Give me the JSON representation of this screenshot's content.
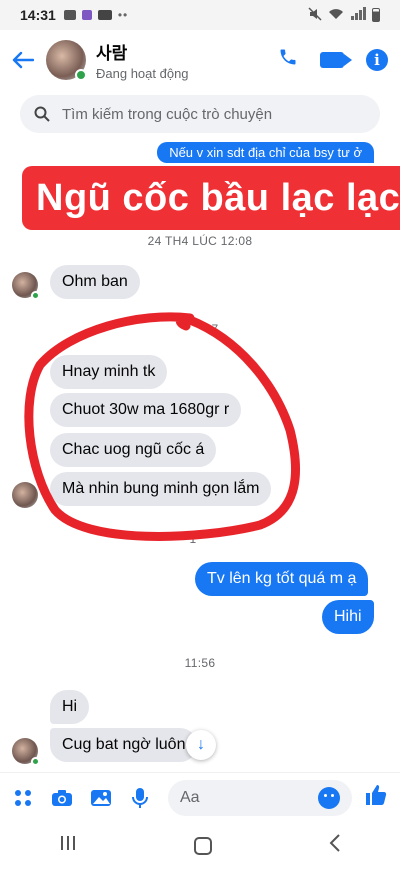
{
  "status_bar": {
    "time": "14:31",
    "dots": "••"
  },
  "header": {
    "name": "사람",
    "status": "Đang hoạt động"
  },
  "search": {
    "placeholder": "Tìm kiếm trong cuộc trò chuyện"
  },
  "overlay": {
    "top_note": "Nếu v xin sdt địa chỉ của bsy tư ở",
    "banner": "Ngũ cốc bầu lạc lạc",
    "highlight_color": "#e8242b"
  },
  "timestamps": {
    "first": "24 TH4 LÚC 12:08",
    "partial1": "7",
    "partial2": "1",
    "second": "11:56"
  },
  "messages": [
    {
      "text": "Ohm ban",
      "direction": "incoming"
    },
    {
      "text": "Hnay minh tk",
      "direction": "incoming"
    },
    {
      "text": "Chuot 30w ma 1680gr r",
      "direction": "incoming"
    },
    {
      "text": "Chac uog ngũ cốc á",
      "direction": "incoming"
    },
    {
      "text": "Mà nhin bung minh gọn lắm",
      "direction": "incoming"
    },
    {
      "text": "Tv lên kg tốt quá m ạ",
      "direction": "outgoing"
    },
    {
      "text": "Hihi",
      "direction": "outgoing"
    },
    {
      "text": "Hi",
      "direction": "incoming"
    },
    {
      "text": "Cug bat ngờ luôn",
      "direction": "incoming"
    }
  ],
  "composer": {
    "placeholder": "Aa"
  },
  "colors": {
    "accent": "#1877f2",
    "online": "#31a24c",
    "banner": "#ef3035"
  },
  "icons": [
    "back-arrow-icon",
    "phone-icon",
    "video-icon",
    "info-icon",
    "search-icon",
    "menu-dots-icon",
    "camera-icon",
    "gallery-icon",
    "microphone-icon",
    "emoji-icon",
    "like-icon",
    "scroll-down-icon"
  ]
}
